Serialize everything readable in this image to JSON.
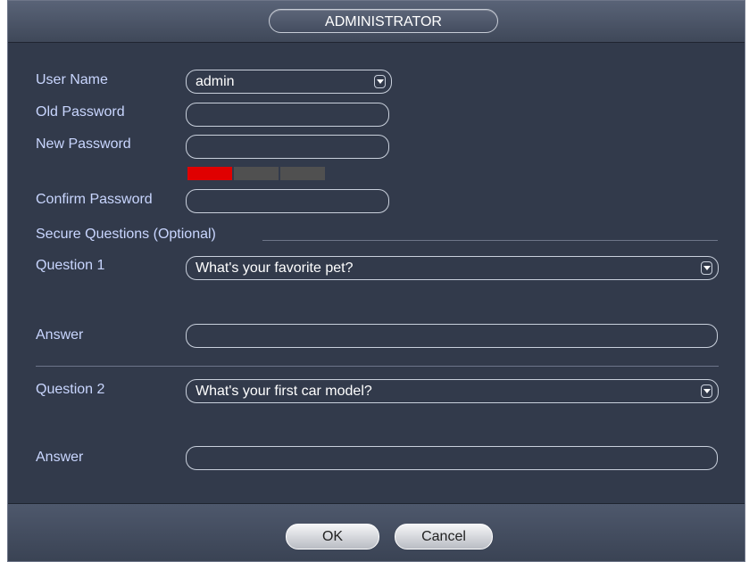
{
  "dialog": {
    "title": "ADMINISTRATOR"
  },
  "form": {
    "user_name_label": "User Name",
    "user_name_value": "admin",
    "old_password_label": "Old Password",
    "new_password_label": "New Password",
    "confirm_password_label": "Confirm Password",
    "secure_questions_label": "Secure Questions (Optional)",
    "question1_label": "Question 1",
    "question1_value": "What's your favorite pet?",
    "answer1_label": "Answer",
    "question2_label": "Question 2",
    "question2_value": "What's your first car model?",
    "answer2_label": "Answer"
  },
  "strength_meter": {
    "segments": 3,
    "active_segments": 1,
    "active_color": "#e00000",
    "inactive_color": "#505050"
  },
  "footer": {
    "ok_label": "OK",
    "cancel_label": "Cancel"
  },
  "colors": {
    "background": "#323a4b",
    "label": "#c9d6ff",
    "field_border": "#c9d0dc"
  }
}
